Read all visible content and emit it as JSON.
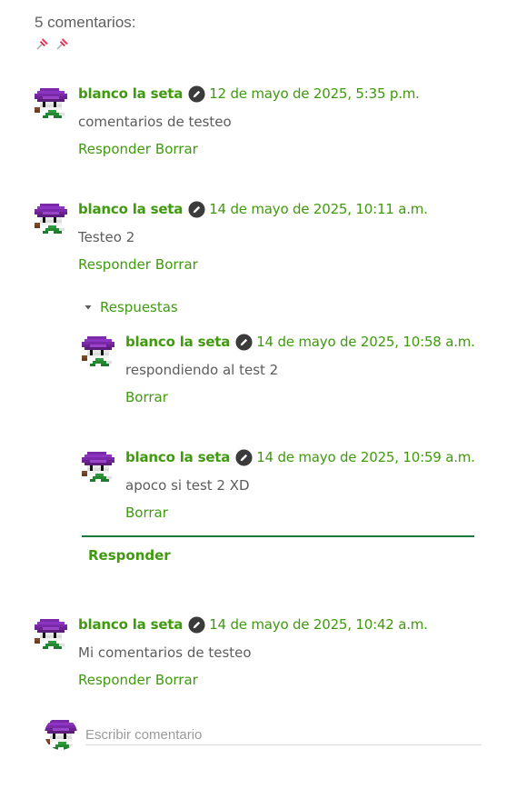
{
  "header": {
    "title": "5 comentarios:",
    "pin_icon_names": [
      "pushpin-icon",
      "pushpin-icon"
    ]
  },
  "colors": {
    "link_green": "#3f9a0d",
    "text_gray": "#5c5c5c",
    "divider_green": "#1a7a3c",
    "avatar_purple": "#7a2aa8"
  },
  "comments": [
    {
      "author": "blanco la seta",
      "date": "12 de mayo de 2025, 5:35 p.m.",
      "text": "comentarios de testeo",
      "reply_label": "Responder",
      "delete_label": "Borrar"
    },
    {
      "author": "blanco la seta",
      "date": "14 de mayo de 2025, 10:11 a.m.",
      "text": "Testeo 2",
      "reply_label": "Responder",
      "delete_label": "Borrar",
      "replies_toggle_label": "Respuestas",
      "replies": [
        {
          "author": "blanco la seta",
          "date": "14 de mayo de 2025, 10:58 a.m.",
          "text": "respondiendo al test 2",
          "delete_label": "Borrar"
        },
        {
          "author": "blanco la seta",
          "date": "14 de mayo de 2025, 10:59 a.m.",
          "text": "apoco si test 2 XD",
          "delete_label": "Borrar"
        }
      ],
      "reply_action_label": "Responder"
    },
    {
      "author": "blanco la seta",
      "date": "14 de mayo de 2025, 10:42 a.m.",
      "text": "Mi comentarios de testeo",
      "reply_label": "Responder",
      "delete_label": "Borrar"
    }
  ],
  "compose": {
    "placeholder": "Escribir comentario"
  }
}
